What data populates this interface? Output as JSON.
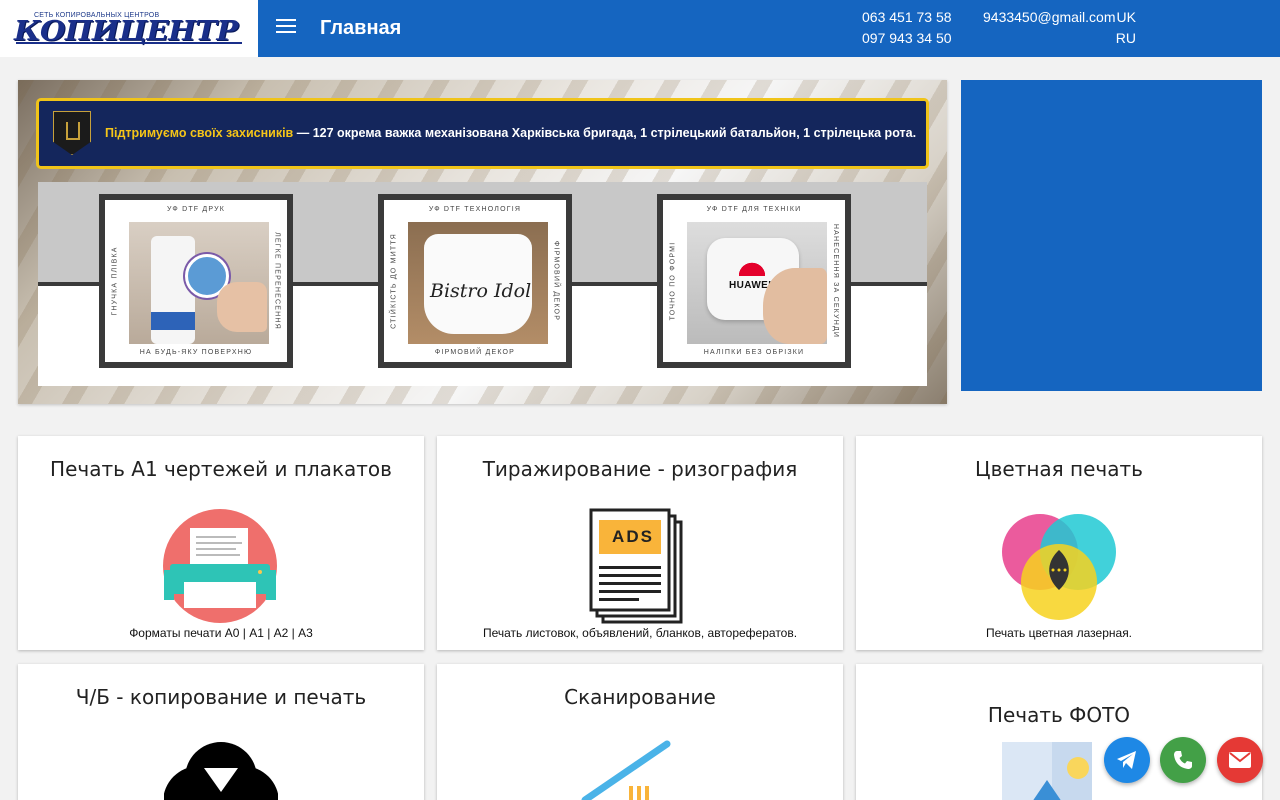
{
  "header": {
    "logo_word": "КОПИЦЕНТР",
    "logo_tagline": "СЕТЬ КОПИРОВАЛЬНЫХ ЦЕНТРОВ",
    "page_title": "Главная",
    "phone_1": "063 451 73 58",
    "phone_2": "097 943 34 50",
    "email": "9433450@gmail.com",
    "lang_uk": "UK",
    "lang_ru": "RU",
    "colors": {
      "brand": "#1565c0",
      "accent": "#f5c518"
    }
  },
  "banner": {
    "notice_strong": "Підтримуємо своїх захисників",
    "notice_text": " — 127 окрема важка механізована Харківська бригада, 1 стрілецький батальйон, 1 стрілецька рота.",
    "cards": [
      {
        "top": "УФ DTF ДРУК",
        "left": "ГНУЧКА ПЛІВКА",
        "right": "ЛЕГКЕ ПЕРЕНЕСЕННЯ",
        "bottom": "НА БУДЬ-ЯКУ ПОВЕРХНЮ"
      },
      {
        "top": "УФ DTF ТЕХНОЛОГІЯ",
        "left": "СТІЙКІСТЬ ДО МИТТЯ",
        "right": "ФІРМОВИЙ ДЕКОР",
        "bottom": "ФІРМОВИЙ ДЕКОР",
        "mug_text": "Bistro Idol"
      },
      {
        "top": "УФ DTF ДЛЯ ТЕХНІКИ",
        "left": "ТОЧНО ПО ФОРМІ",
        "right": "НАНЕСЕННЯ ЗА СЕКУНДИ",
        "bottom": "НАЛІПКИ БЕЗ ОБРІЗКИ",
        "brand_text": "HUAWEI"
      }
    ]
  },
  "services": [
    {
      "title": "Печать А1 чертежей и плакатов",
      "subtitle": "Форматы печати А0 | А1 | А2 | А3",
      "icon": "printer-icon"
    },
    {
      "title": "Тиражирование - ризография",
      "subtitle": "Печать листовок, объявлений, бланков, авторефератов.",
      "icon": "ads-document-icon",
      "icon_label": "ADS"
    },
    {
      "title": "Цветная печать",
      "subtitle": "Печать цветная лазерная.",
      "icon": "color-circles-icon"
    },
    {
      "title": "Ч/Б - копирование и печать",
      "subtitle": "",
      "icon": "bw-circles-icon"
    },
    {
      "title": "Сканирование",
      "subtitle": "",
      "icon": "scanner-icon"
    },
    {
      "title": "Печать ФОТО",
      "subtitle": "",
      "icon": "photo-icon"
    }
  ],
  "floating": [
    "telegram-icon",
    "phone-icon",
    "mail-icon"
  ]
}
